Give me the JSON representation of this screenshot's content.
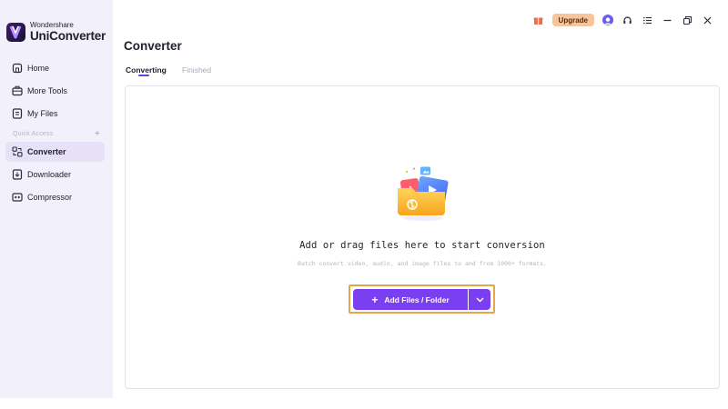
{
  "brand": {
    "company": "Wondershare",
    "product": "UniConverter"
  },
  "sidebar": {
    "items": [
      {
        "label": "Home",
        "icon": "home-icon"
      },
      {
        "label": "More Tools",
        "icon": "toolbox-icon"
      },
      {
        "label": "My Files",
        "icon": "file-icon"
      },
      {
        "label": "Converter",
        "icon": "converter-icon",
        "active": true
      },
      {
        "label": "Downloader",
        "icon": "download-icon"
      },
      {
        "label": "Compressor",
        "icon": "compress-icon"
      }
    ],
    "quick_access_label": "Quick Access",
    "quick_access_add": "+"
  },
  "topbar": {
    "upgrade_label": "Upgrade",
    "icons": [
      "gift-icon",
      "avatar",
      "headset-icon",
      "menu-icon",
      "minimize-icon",
      "restore-icon",
      "close-icon"
    ]
  },
  "main": {
    "title": "Converter",
    "tabs": [
      {
        "label": "Converting",
        "active": true
      },
      {
        "label": "Finished",
        "active": false
      }
    ],
    "drop_title": "Add or drag files here to start conversion",
    "drop_subtitle": "Batch convert video, audio, and image files to and from 1000+ formats.",
    "add_button_label": "Add Files / Folder",
    "add_button_icon": "+"
  },
  "colors": {
    "accent": "#7b3ff2",
    "upgrade_bg": "#f7c49b",
    "sidebar_bg": "#f2f0fb",
    "highlight": "#e3a74a"
  }
}
